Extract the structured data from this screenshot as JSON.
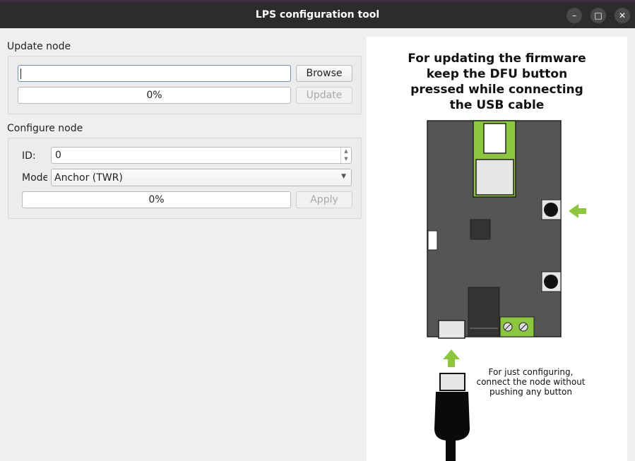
{
  "window": {
    "title": "LPS configuration tool",
    "minimize_glyph": "–",
    "maximize_glyph": "□",
    "close_glyph": "✕"
  },
  "update_node": {
    "section_label": "Update node",
    "file_value": "",
    "browse_label": "Browse",
    "progress_text": "0%",
    "update_label": "Update"
  },
  "configure_node": {
    "section_label": "Configure node",
    "id_label": "ID:",
    "id_value": "0",
    "mode_label": "Mode",
    "mode_value": "Anchor (TWR)",
    "progress_text": "0%",
    "apply_label": "Apply"
  },
  "instructions": {
    "line1": "For updating the firmware",
    "line2": "keep the DFU button",
    "line3": "pressed while connecting",
    "line4": "the USB cable",
    "note1": "For just configuring,",
    "note2": "connect the node without",
    "note3": "pushing any button"
  },
  "colors": {
    "accent_green": "#8cc63f",
    "board_gray": "#555555",
    "titlebar": "#2c2c2c"
  },
  "icons": [
    "minimize-icon",
    "maximize-icon",
    "close-icon",
    "spin-up-icon",
    "spin-down-icon",
    "dropdown-arrow-icon",
    "arrow-left-icon",
    "arrow-up-icon"
  ]
}
